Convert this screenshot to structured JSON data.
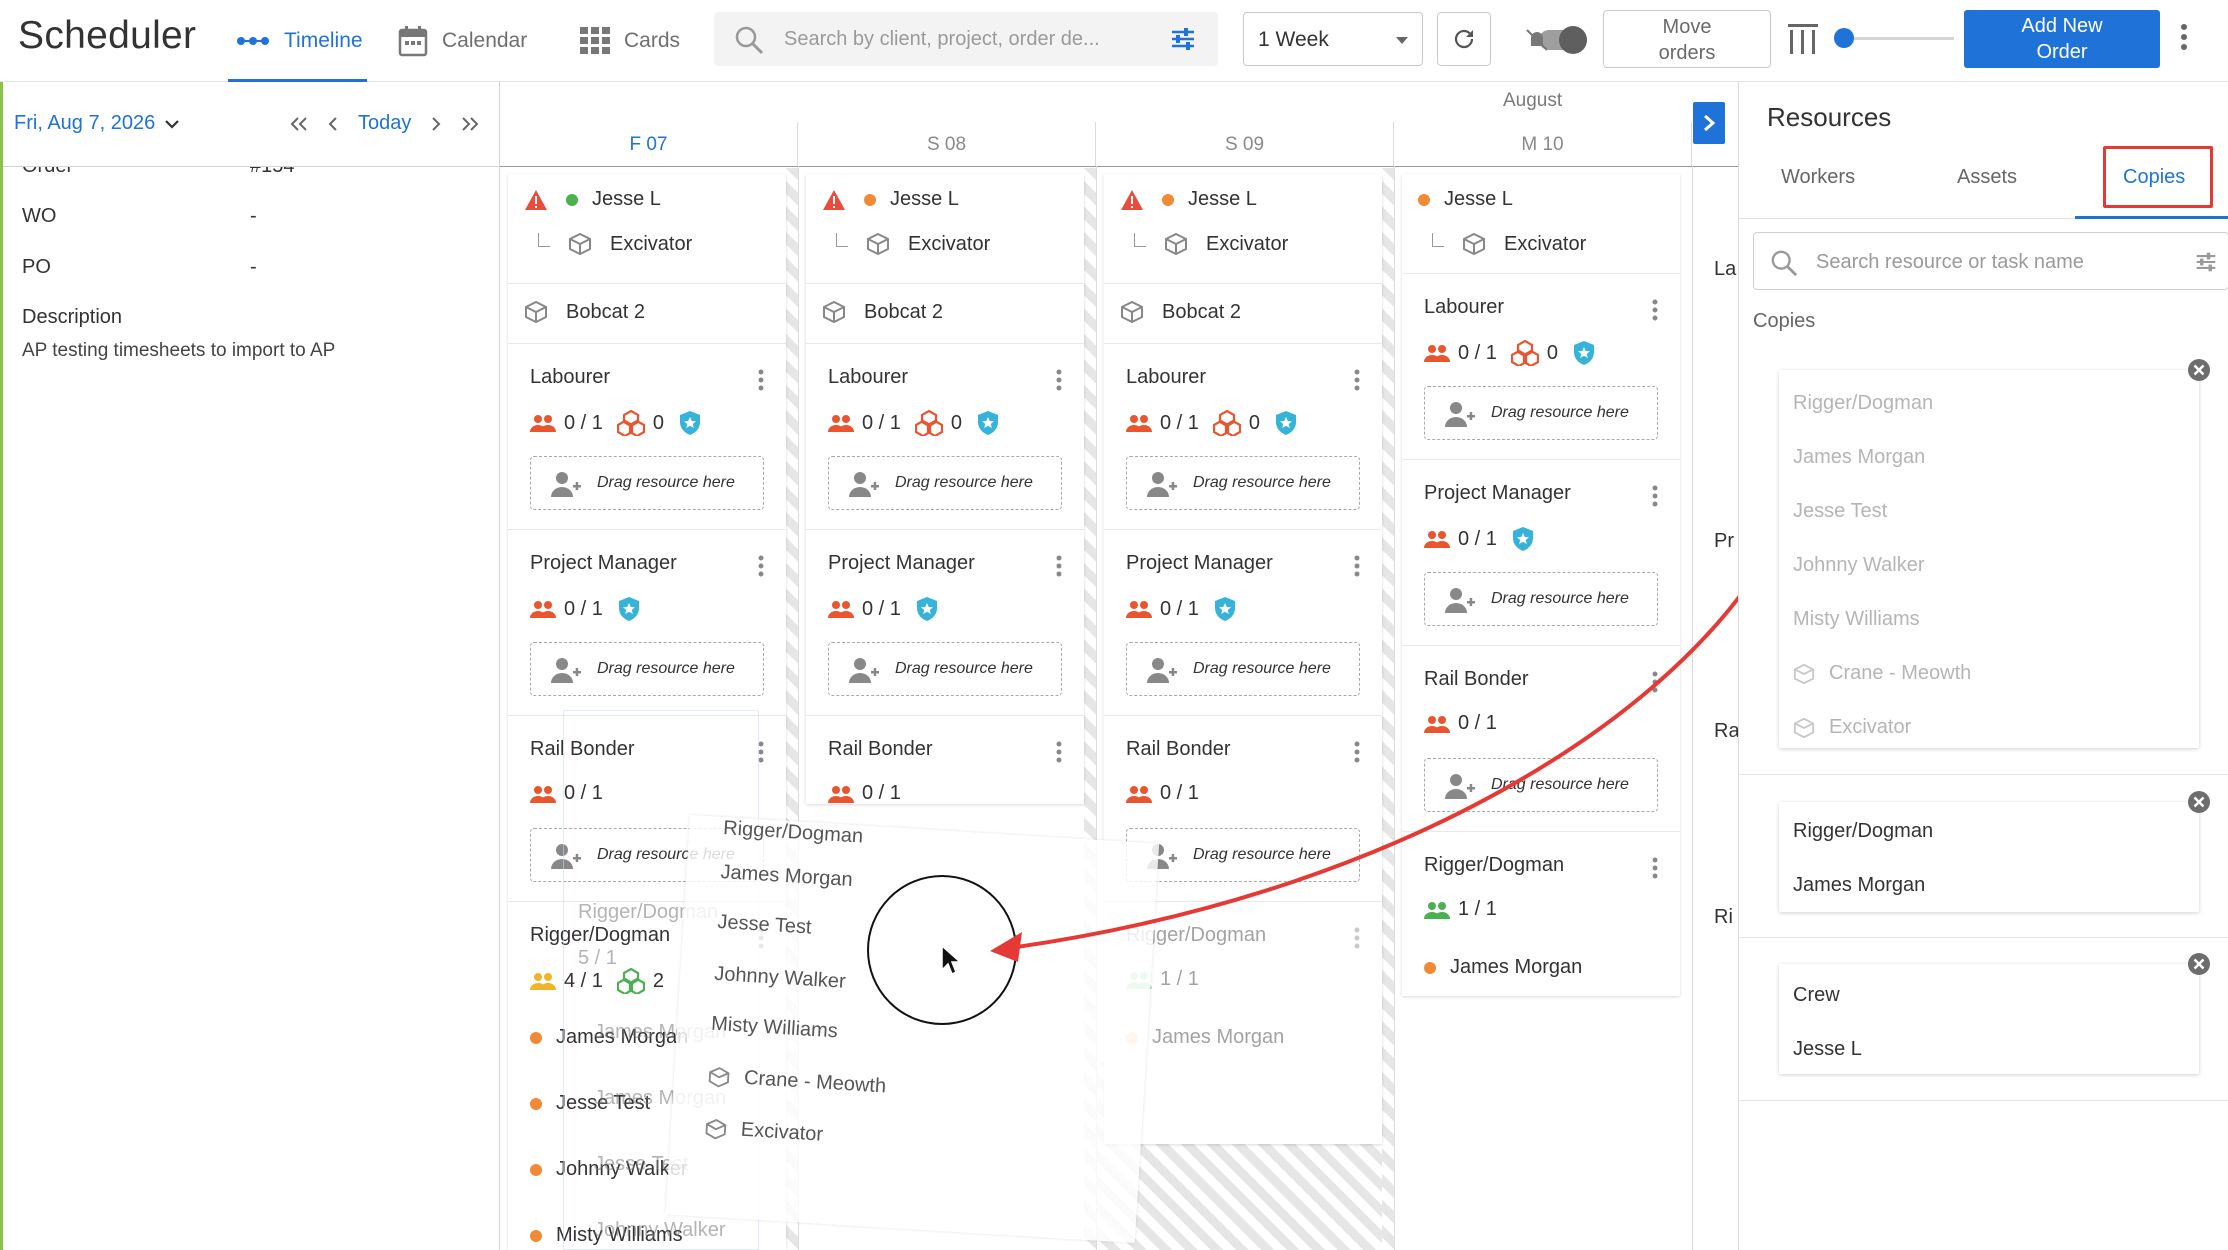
{
  "header": {
    "title": "Scheduler",
    "views": [
      {
        "label": "Timeline",
        "active": true
      },
      {
        "label": "Calendar",
        "active": false
      },
      {
        "label": "Cards",
        "active": false
      }
    ],
    "search_placeholder": "Search by client, project, order de...",
    "range_select": "1 Week",
    "move_orders_line1": "Move",
    "move_orders_line2": "orders",
    "add_order_line1": "Add New",
    "add_order_line2": "Order",
    "accent_color": "#1e72d8"
  },
  "left_panel": {
    "date": "Fri, Aug 7, 2026",
    "today_label": "Today",
    "fields": [
      {
        "label": "Order",
        "value": "#154"
      },
      {
        "label": "WO",
        "value": "-"
      },
      {
        "label": "PO",
        "value": "-"
      }
    ],
    "description_label": "Description",
    "description": "AP testing timesheets to import to AP"
  },
  "timeline": {
    "month": "August",
    "days": [
      {
        "label": "F 07",
        "active": true
      },
      {
        "label": "S 08",
        "active": false
      },
      {
        "label": "S 09",
        "active": false
      },
      {
        "label": "M 10",
        "active": false
      }
    ],
    "crew_lead": "Jesse L",
    "equipment_child": "Excivator",
    "equipment_2": "Bobcat 2",
    "drag_hint": "Drag resource here",
    "roles": {
      "labourer": "Labourer",
      "project_manager": "Project Manager",
      "rail_bonder": "Rail Bonder",
      "rigger": "Rigger/Dogman"
    },
    "stats": {
      "zero_of_one": "0 / 1",
      "zero": "0",
      "four_of_one": "4 / 1",
      "two": "2",
      "one_of_one": "1 / 1",
      "five_of_one": "5 / 1"
    },
    "members": [
      "James Morgan",
      "Jesse Test",
      "Johnny Walker",
      "Misty Williams"
    ]
  },
  "drag_preview": {
    "items": [
      "Rigger/Dogman",
      "James Morgan",
      "Jesse Test",
      "Johnny Walker",
      "Misty Williams",
      "Crane - Meowth",
      "Excivator"
    ]
  },
  "ghost_column": {
    "title": "Rigger/Dogman",
    "stat": "5 / 1",
    "rows": [
      "James Morgan",
      "James Morgan",
      "Jesse Test",
      "Johnny Walker"
    ]
  },
  "resources": {
    "title": "Resources",
    "tabs": [
      {
        "label": "Workers",
        "active": false
      },
      {
        "label": "Assets",
        "active": false
      },
      {
        "label": "Copies",
        "active": true
      }
    ],
    "search_placeholder": "Search resource or task name",
    "section_label": "Copies",
    "copies": [
      {
        "items": [
          "Rigger/Dogman",
          "James Morgan",
          "Jesse Test",
          "Johnny Walker",
          "Misty Williams",
          "Crane - Meowth",
          "Excivator"
        ]
      },
      {
        "items": [
          "Rigger/Dogman",
          "James Morgan"
        ]
      },
      {
        "items": [
          "Crew",
          "Jesse L"
        ]
      }
    ]
  },
  "peek_column": {
    "items": [
      "La",
      "Pr",
      "Ra",
      "Ri"
    ]
  }
}
